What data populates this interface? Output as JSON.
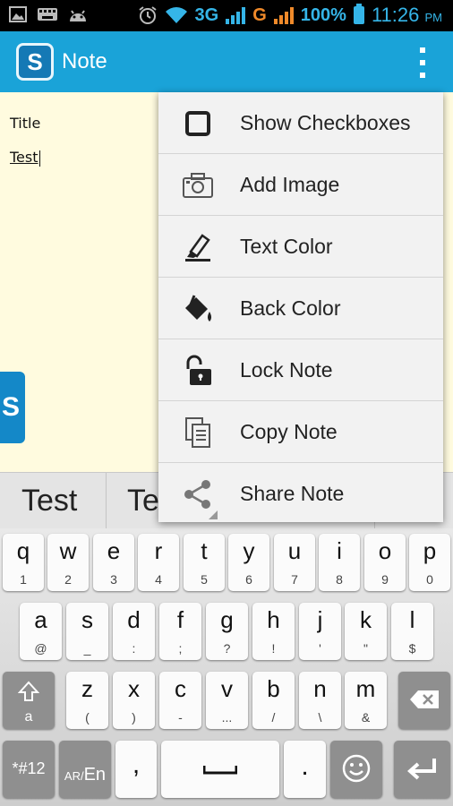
{
  "status_bar": {
    "network": "3G",
    "carrier_g": "G",
    "battery": "100%",
    "time": "11:26",
    "ampm": "PM"
  },
  "action_bar": {
    "app_icon_letter": "S",
    "title": "Note"
  },
  "note": {
    "title": "Title",
    "body": "Test",
    "side_tab_letter": "S"
  },
  "menu": {
    "items": [
      {
        "label": "Show Checkboxes",
        "icon": "checkbox-icon"
      },
      {
        "label": "Add Image",
        "icon": "camera-icon"
      },
      {
        "label": "Text Color",
        "icon": "highlighter-icon"
      },
      {
        "label": "Back Color",
        "icon": "paint-bucket-icon"
      },
      {
        "label": "Lock Note",
        "icon": "unlock-icon"
      },
      {
        "label": "Copy Note",
        "icon": "copy-icon"
      },
      {
        "label": "Share Note",
        "icon": "share-icon"
      }
    ]
  },
  "suggestions": {
    "first": "Test",
    "second": "Te"
  },
  "keyboard": {
    "row1": [
      {
        "main": "q",
        "sub": "1"
      },
      {
        "main": "w",
        "sub": "2"
      },
      {
        "main": "e",
        "sub": "3"
      },
      {
        "main": "r",
        "sub": "4"
      },
      {
        "main": "t",
        "sub": "5"
      },
      {
        "main": "y",
        "sub": "6"
      },
      {
        "main": "u",
        "sub": "7"
      },
      {
        "main": "i",
        "sub": "8"
      },
      {
        "main": "o",
        "sub": "9"
      },
      {
        "main": "p",
        "sub": "0"
      }
    ],
    "row2": [
      {
        "main": "a",
        "sub": "@"
      },
      {
        "main": "s",
        "sub": "_"
      },
      {
        "main": "d",
        "sub": ":"
      },
      {
        "main": "f",
        "sub": ";"
      },
      {
        "main": "g",
        "sub": "?"
      },
      {
        "main": "h",
        "sub": "!"
      },
      {
        "main": "j",
        "sub": "'"
      },
      {
        "main": "k",
        "sub": "\""
      },
      {
        "main": "l",
        "sub": "$"
      }
    ],
    "row3": [
      {
        "main": "z",
        "sub": "("
      },
      {
        "main": "x",
        "sub": ")"
      },
      {
        "main": "c",
        "sub": "-"
      },
      {
        "main": "v",
        "sub": "..."
      },
      {
        "main": "b",
        "sub": "/"
      },
      {
        "main": "n",
        "sub": "\\"
      },
      {
        "main": "m",
        "sub": "&"
      }
    ],
    "shift_sub": "a",
    "symbols_label": "*#12",
    "lang_small": "AR/",
    "lang_big": "En",
    "comma": ",",
    "period": "."
  },
  "colors": {
    "action_bar": "#1aa3d8",
    "note_background": "#fffbdf",
    "status_accent": "#35b5e8",
    "status_orange": "#f08a2a"
  }
}
